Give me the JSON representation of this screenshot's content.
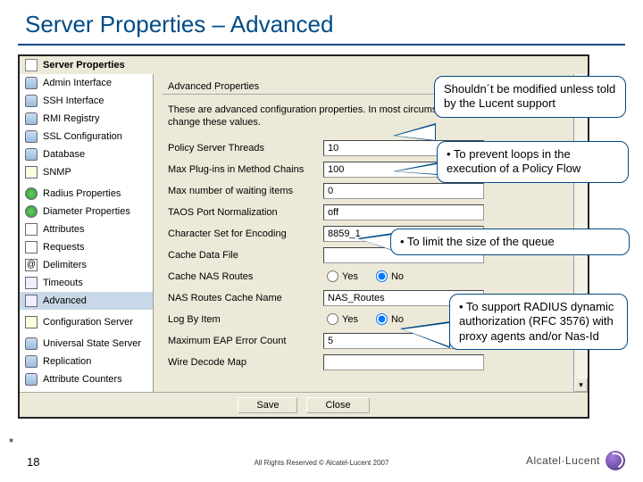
{
  "slide": {
    "title": "Server Properties – Advanced",
    "page_number": "18",
    "asterisk": "*",
    "copyright": "All Rights Reserved © Alcatel-Lucent 2007"
  },
  "logo": {
    "brand": "Alcatel·Lucent"
  },
  "window": {
    "title": "Server Properties"
  },
  "sidebar": {
    "items": [
      {
        "label": "Admin Interface"
      },
      {
        "label": "SSH Interface"
      },
      {
        "label": "RMI Registry"
      },
      {
        "label": "SSL Configuration"
      },
      {
        "label": "Database"
      },
      {
        "label": "SNMP"
      },
      {
        "label": "Radius Properties"
      },
      {
        "label": "Diameter Properties"
      },
      {
        "label": "Attributes"
      },
      {
        "label": "Requests"
      },
      {
        "label": "Delimiters"
      },
      {
        "label": "Timeouts"
      },
      {
        "label": "Advanced"
      },
      {
        "label": "Configuration Server"
      },
      {
        "label": "Universal State Server"
      },
      {
        "label": "Replication"
      },
      {
        "label": "Attribute Counters"
      }
    ]
  },
  "panel": {
    "group_title": "Advanced Properties",
    "description": "These are advanced configuration properties. In most circumstances, you will not need to change these values.",
    "rows": [
      {
        "label": "Policy Server Threads",
        "value": "10",
        "type": "text"
      },
      {
        "label": "Max Plug-ins in Method Chains",
        "value": "100",
        "type": "text"
      },
      {
        "label": "Max number of waiting items",
        "value": "0",
        "type": "text"
      },
      {
        "label": "TAOS Port Normalization",
        "value": "off",
        "type": "select"
      },
      {
        "label": "Character Set for Encoding",
        "value": "8859_1",
        "type": "select"
      },
      {
        "label": "Cache Data File",
        "value": "",
        "type": "text"
      },
      {
        "label": "Cache NAS Routes",
        "value": "No",
        "type": "radio"
      },
      {
        "label": "NAS Routes Cache Name",
        "value": "NAS_Routes",
        "type": "text"
      },
      {
        "label": "Log By Item",
        "value": "No",
        "type": "radio"
      },
      {
        "label": "Maximum EAP Error Count",
        "value": "5",
        "type": "text"
      },
      {
        "label": "Wire Decode Map",
        "value": "",
        "type": "text"
      }
    ],
    "radio_options": {
      "yes": "Yes",
      "no": "No"
    }
  },
  "buttons": {
    "save": "Save",
    "close": "Close"
  },
  "callouts": {
    "c1": "Shouldn´t be modified unless told by the Lucent support",
    "c2": "• To prevent loops in the execution of a Policy Flow",
    "c3": "• To limit the size of the queue",
    "c4": "• To support RADIUS dynamic authorization (RFC 3576) with proxy agents and/or Nas-Id"
  }
}
